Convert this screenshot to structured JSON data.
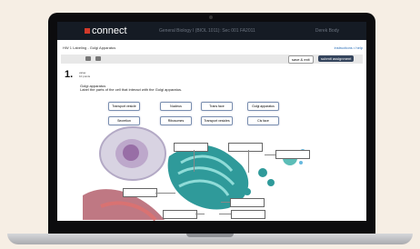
{
  "topbar": {
    "brand": "connect",
    "course": "General Biology I (BIOL 1011): Sec 001 FA2011",
    "user": "Derek Body"
  },
  "breadcrumb": "HW 1 Labeling - Golgi Apparatus",
  "instructions": "instructions • help",
  "toolbar": {
    "save_exit": "save & exit",
    "submit": "submit assignment"
  },
  "question": {
    "number": "1.",
    "info_line1": "value:",
    "info_line2": "10 points",
    "title": "Golgi apparatus",
    "prompt": "Label the parts of the cell that interact with the Golgi apparatus."
  },
  "labels": [
    "Transport vesicle",
    "Nucleus",
    "Trans face",
    "Golgi apparatus",
    "Secretion",
    "Ribosomes",
    "Transport vesicles",
    "Cis face"
  ]
}
